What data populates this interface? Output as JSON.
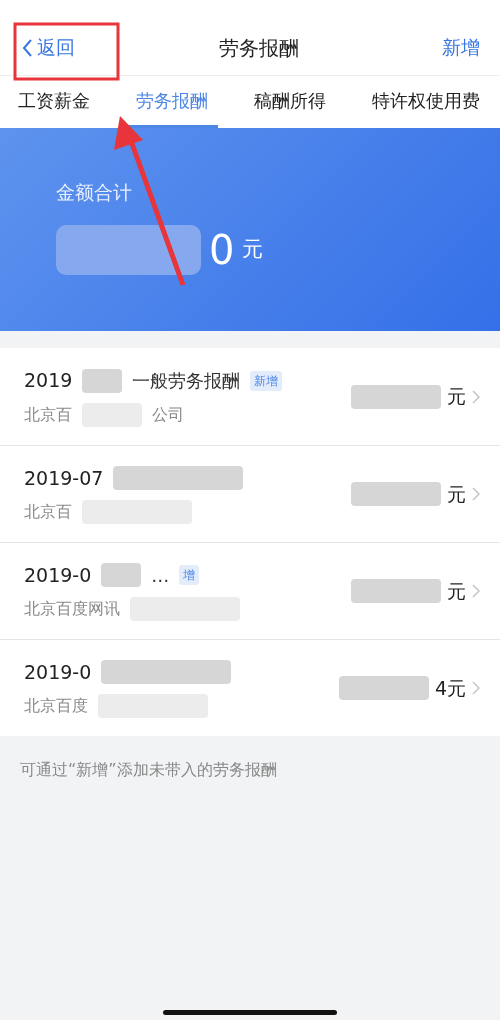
{
  "nav": {
    "back": "返回",
    "title": "劳务报酬",
    "action": "新增"
  },
  "tabs": [
    {
      "label": "工资薪金",
      "selected": false
    },
    {
      "label": "劳务报酬",
      "selected": true
    },
    {
      "label": "稿酬所得",
      "selected": false
    },
    {
      "label": "特许权使用费",
      "selected": false
    }
  ],
  "summary": {
    "label": "金额合计",
    "amount": "0",
    "unit": "元"
  },
  "records": [
    {
      "date": "2019",
      "title": "一般劳务报酬",
      "badge": "新增",
      "amount": "元",
      "company": "北京百",
      "company_tail": "公司"
    },
    {
      "date": "2019-07",
      "amount": "元",
      "company": "北京百"
    },
    {
      "date": "2019-0",
      "title": "…",
      "badge": "增",
      "amount": "元",
      "company": "北京百度网讯"
    },
    {
      "date": "2019-0",
      "amount": "4元",
      "company": "北京百度"
    }
  ],
  "footer_note": "可通过“新增”添加未带入的劳务报酬"
}
